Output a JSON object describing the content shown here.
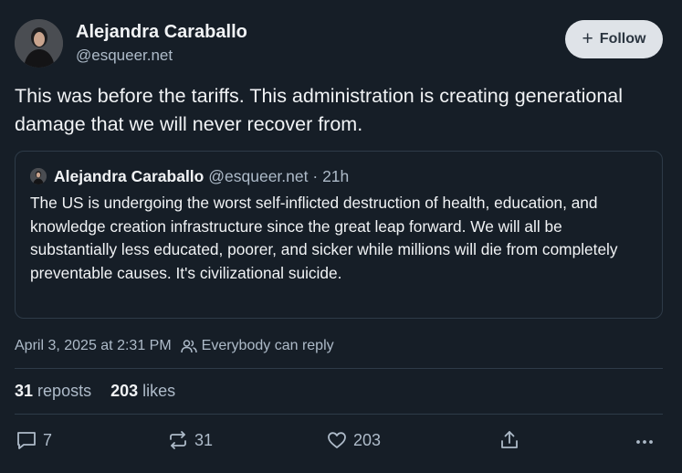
{
  "author": {
    "name": "Alejandra Caraballo",
    "handle": "@esqueer.net"
  },
  "follow_label": "Follow",
  "post_text": "This was before the tariffs. This administration is creating generational damage that we will never recover from.",
  "quote": {
    "name": "Alejandra Caraballo",
    "handle": "@esqueer.net",
    "dot": "·",
    "time": "21h",
    "text": "The US is undergoing the worst self-inflicted destruction of health, education, and knowledge creation infrastructure since the great leap forward. We will all be substantially less educated, poorer, and sicker while millions will die from completely preventable causes. It's civilizational suicide."
  },
  "meta": {
    "timestamp": "April 3, 2025 at 2:31 PM",
    "reply_setting": "Everybody can reply"
  },
  "stats": {
    "reposts_count": "31",
    "reposts_label": "reposts",
    "likes_count": "203",
    "likes_label": "likes"
  },
  "actions": {
    "reply_count": "7",
    "repost_count": "31",
    "like_count": "203"
  },
  "icons": {
    "reply": "reply-icon",
    "repost": "repost-icon",
    "like": "heart-icon",
    "share": "share-icon",
    "more": "more-icon",
    "people": "people-icon"
  },
  "colors": {
    "background": "#161e27",
    "text": "#f1f3f5",
    "muted": "#aebbc9",
    "border": "#2e3b48",
    "follow_bg": "#dfe3e8"
  }
}
